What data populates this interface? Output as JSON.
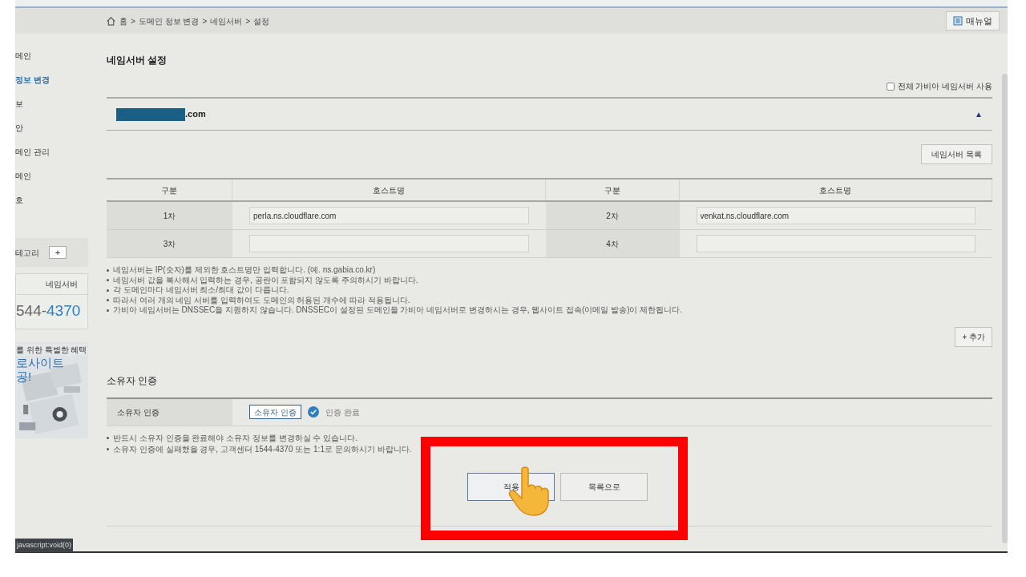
{
  "breadcrumb": {
    "items": [
      "홈",
      "도메인 정보 변경",
      "네임서버",
      "설정"
    ],
    "separator": ">"
  },
  "manual_button": "매뉴얼",
  "sidebar": {
    "items": [
      {
        "label": "메인",
        "selected": false
      },
      {
        "label": "정보 변경",
        "selected": true
      },
      {
        "label": "보",
        "selected": false
      },
      {
        "label": "안",
        "selected": false
      },
      {
        "label": "메인 관리",
        "selected": false
      },
      {
        "label": "메인",
        "selected": false
      },
      {
        "label": "호",
        "selected": false
      }
    ],
    "category": {
      "label": "테고리",
      "add": "+"
    },
    "contact": {
      "header": "네임서버",
      "phone_prefix": "544-",
      "phone_suffix": "4370"
    },
    "banner": {
      "subtitle": "를 위한 특별한 혜택",
      "title_lines": [
        "로사이트",
        "공!"
      ]
    }
  },
  "title": "네임서버 설정",
  "use_all_gabia": {
    "label": "전체 가비아 네임서버 사용",
    "checked": false
  },
  "domain": {
    "suffix": ".com",
    "expanded": true,
    "toggle": "▲"
  },
  "nameserver_list_button": "네임서버 목록",
  "table": {
    "columns": [
      "구분",
      "호스트명",
      "구분",
      "호스트명"
    ],
    "rows": [
      [
        {
          "label": "1차",
          "value": "perla.ns.cloudflare.com"
        },
        {
          "label": "2차",
          "value": "venkat.ns.cloudflare.com"
        }
      ],
      [
        {
          "label": "3차"
        },
        {
          "label": "4차"
        }
      ]
    ]
  },
  "notes": [
    "네임서버는 IP(숫자)를 제외한 호스트명만 입력합니다. (예. ns.gabia.co.kr)",
    "네임서버 값을 복사해서 입력하는 경우, 공란이 포함되지 않도록 주의하시기 바랍니다.",
    "각 도메인마다 네임서버 최소/최대 값이 다릅니다.",
    "따라서 여러 개의 네임 서버를 입력하여도 도메인의 허용된 개수에 따라 적용됩니다.",
    "가비아 네임서버는 DNSSEC을 지원하지 않습니다. DNSSEC이 설정된 도메인을 가비아 네임서버로 변경하시는 경우, 웹사이트 접속(이메일 발송)이 제한됩니다."
  ],
  "add_button": "+ 추가",
  "owner": {
    "title": "소유자 인증",
    "label": "소유자 인증",
    "button": "소유자 인증",
    "verified": true,
    "status": "인증 완료",
    "notes": [
      "반드시 소유자 인증을 완료해야 소유자 정보를 변경하실 수 있습니다.",
      "소유자 인증에 실패했을 경우, 고객센터 1544-4370 또는 1:1로 문의하시기 바랍니다."
    ]
  },
  "actions": [
    "적용",
    "목록으로"
  ],
  "status_url": "javascript:void(0)"
}
